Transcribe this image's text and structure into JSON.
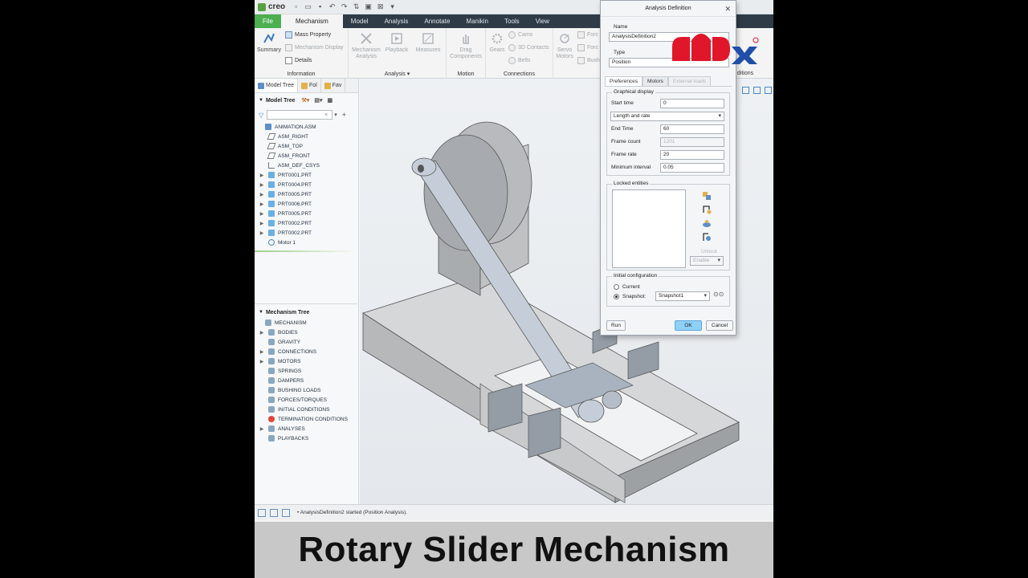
{
  "app": {
    "logo_text": "creo",
    "tabs": [
      "File",
      "Mechanism",
      "Model",
      "Analysis",
      "Annotate",
      "Manikin",
      "Tools",
      "View"
    ]
  },
  "ribbon": {
    "information": {
      "label": "Information",
      "summary": "Summary",
      "mass_property": "Mass Property",
      "mechanism_display": "Mechanism Display",
      "details": "Details"
    },
    "analysis": {
      "label": "Analysis",
      "mechanism_analysis": "Mechanism Analysis",
      "playback": "Playback",
      "measures": "Measures"
    },
    "motion": {
      "label": "Motion",
      "drag_components": "Drag Components"
    },
    "connections": {
      "label": "Connections",
      "gears": "Gears",
      "cams": "Cams",
      "contacts_3d": "3D Contacts",
      "belts": "Belts"
    },
    "servo_motors": "Servo Motors",
    "partial": [
      "Forc",
      "Forc",
      "Bush"
    ],
    "conditions_partial": "ditions"
  },
  "model_tree": {
    "tabs": [
      "Model Tree",
      "Fol",
      "Fav"
    ],
    "header": "Model Tree",
    "items": [
      {
        "label": "ANIMATION.ASM",
        "icon": "assembly-icon",
        "exp": ""
      },
      {
        "label": "ASM_RIGHT",
        "icon": "datum-plane-icon",
        "exp": ""
      },
      {
        "label": "ASM_TOP",
        "icon": "datum-plane-icon",
        "exp": ""
      },
      {
        "label": "ASM_FRONT",
        "icon": "datum-plane-icon",
        "exp": ""
      },
      {
        "label": "ASM_DEF_CSYS",
        "icon": "csys-icon",
        "exp": ""
      },
      {
        "label": "PRT0001.PRT",
        "icon": "part-icon",
        "exp": "▶"
      },
      {
        "label": "PRT0004.PRT",
        "icon": "part-icon",
        "exp": "▶"
      },
      {
        "label": "PRT0005.PRT",
        "icon": "part-icon",
        "exp": "▶"
      },
      {
        "label": "PRT0006.PRT",
        "icon": "part-icon",
        "exp": "▶"
      },
      {
        "label": "PRT0005.PRT",
        "icon": "part-icon",
        "exp": "▶"
      },
      {
        "label": "PRT0002.PRT",
        "icon": "part-icon",
        "exp": "▶"
      },
      {
        "label": "PRT0002.PRT",
        "icon": "part-icon",
        "exp": "▶"
      },
      {
        "label": "Motor 1",
        "icon": "motor-icon",
        "exp": ""
      }
    ]
  },
  "mechanism_tree": {
    "header": "Mechanism Tree",
    "items": [
      {
        "label": "MECHANISM",
        "exp": ""
      },
      {
        "label": "BODIES",
        "exp": "▶"
      },
      {
        "label": "GRAVITY",
        "exp": ""
      },
      {
        "label": "CONNECTIONS",
        "exp": "▶"
      },
      {
        "label": "MOTORS",
        "exp": "▶"
      },
      {
        "label": "SPRINGS",
        "exp": ""
      },
      {
        "label": "DAMPERS",
        "exp": ""
      },
      {
        "label": "BUSHING LOADS",
        "exp": ""
      },
      {
        "label": "FORCES/TORQUES",
        "exp": ""
      },
      {
        "label": "INITIAL CONDITIONS",
        "exp": ""
      },
      {
        "label": "TERMINATION CONDITIONS",
        "exp": ""
      },
      {
        "label": "ANALYSES",
        "exp": "▶"
      },
      {
        "label": "PLAYBACKS",
        "exp": ""
      }
    ]
  },
  "dialog": {
    "title": "Analysis Definition",
    "name_label": "Name",
    "name_value": "AnalysisDefinition2",
    "type_label": "Type",
    "type_value": "Position",
    "tabs": [
      "Preferences",
      "Motors",
      "External loads"
    ],
    "graphical_display": "Graphical display",
    "start_time_label": "Start time",
    "start_time_value": "0",
    "mode_value": "Length and rate",
    "end_time_label": "End Time",
    "end_time_value": "60",
    "frame_count_label": "Frame count",
    "frame_count_value": "1201",
    "frame_rate_label": "Frame rate",
    "frame_rate_value": "20",
    "min_interval_label": "Minimum interval",
    "min_interval_value": "0.05",
    "locked_entities": "Locked entities",
    "unlock_label": "Unlock",
    "enable_label": "Enable",
    "initial_configuration": "Initial configuration",
    "current_label": "Current",
    "snapshot_label": "Snapshot:",
    "snapshot_value": "Snapshot1",
    "run": "Run",
    "ok": "OK",
    "cancel": "Cancel"
  },
  "status_message": "AnalysisDefinition2 started (Position Analysis).",
  "caption": "Rotary Slider Mechanism",
  "colors": {
    "brand_red": "#e0162b",
    "brand_blue": "#1f4fa8",
    "file_tab": "#4caf50",
    "ok_button": "#8fd0f7"
  }
}
